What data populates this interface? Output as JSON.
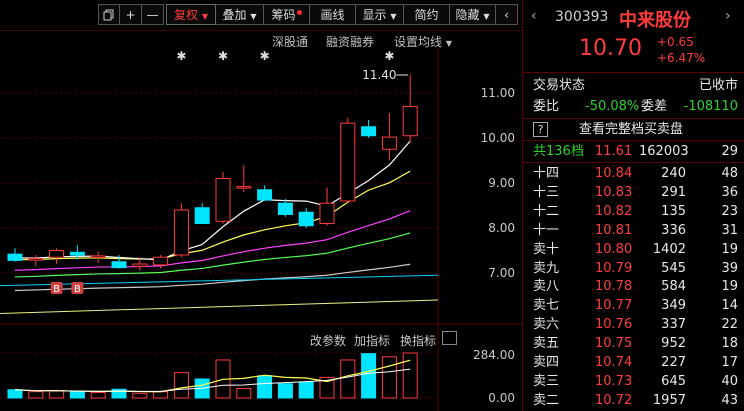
{
  "toolbar": {
    "copy_icon": "copy-icon",
    "plus": "+",
    "minus": "—",
    "fuquan": "复权",
    "diejia": "叠加",
    "chouma": "筹码",
    "huaxian": "画线",
    "xianshi": "显示",
    "jianyue": "简约",
    "yincang": "隐藏"
  },
  "subtoolbar": {
    "shengutong": "深股通",
    "rongzirongquan": "融资融券",
    "shezhi_junxian": "设置均线"
  },
  "chart": {
    "yticks": [
      "11.00",
      "10.00",
      "9.00",
      "8.00",
      "7.00"
    ],
    "max_label": "11.40",
    "b_marker": "B",
    "vol_tabs": {
      "gai": "改参数",
      "jia": "加指标",
      "huan": "换指标"
    },
    "vol_yticks": [
      "284.00",
      "0.00"
    ],
    "colors": {
      "up": "#ff3b3b",
      "down": "#00e5ff",
      "ma5": "#ffffff",
      "ma10": "#ffff55",
      "ma20": "#ff40ff",
      "ma30": "#55ff55",
      "ma60": "#cccccc"
    }
  },
  "chart_data": {
    "type": "candlestick",
    "candles": [
      {
        "o": 7.42,
        "h": 7.55,
        "l": 7.25,
        "c": 7.28
      },
      {
        "o": 7.3,
        "h": 7.4,
        "l": 7.15,
        "c": 7.32
      },
      {
        "o": 7.35,
        "h": 7.55,
        "l": 7.2,
        "c": 7.5
      },
      {
        "o": 7.46,
        "h": 7.62,
        "l": 7.3,
        "c": 7.4
      },
      {
        "o": 7.35,
        "h": 7.48,
        "l": 7.22,
        "c": 7.38
      },
      {
        "o": 7.25,
        "h": 7.4,
        "l": 7.1,
        "c": 7.12
      },
      {
        "o": 7.15,
        "h": 7.35,
        "l": 7.05,
        "c": 7.2
      },
      {
        "o": 7.18,
        "h": 7.4,
        "l": 7.1,
        "c": 7.35
      },
      {
        "o": 7.4,
        "h": 8.55,
        "l": 7.35,
        "c": 8.4
      },
      {
        "o": 8.45,
        "h": 8.55,
        "l": 8.1,
        "c": 8.1
      },
      {
        "o": 8.15,
        "h": 9.25,
        "l": 8.1,
        "c": 9.1
      },
      {
        "o": 8.9,
        "h": 9.4,
        "l": 8.8,
        "c": 8.92
      },
      {
        "o": 8.85,
        "h": 8.95,
        "l": 8.6,
        "c": 8.62
      },
      {
        "o": 8.55,
        "h": 8.65,
        "l": 8.25,
        "c": 8.3
      },
      {
        "o": 8.35,
        "h": 8.45,
        "l": 8.0,
        "c": 8.05
      },
      {
        "o": 8.1,
        "h": 8.9,
        "l": 8.05,
        "c": 8.55
      },
      {
        "o": 8.6,
        "h": 10.45,
        "l": 8.55,
        "c": 10.33
      },
      {
        "o": 10.25,
        "h": 10.4,
        "l": 10.0,
        "c": 10.05
      },
      {
        "o": 9.75,
        "h": 10.55,
        "l": 9.5,
        "c": 10.02
      },
      {
        "o": 10.05,
        "h": 11.4,
        "l": 9.9,
        "c": 10.7
      }
    ],
    "volumes": [
      52,
      40,
      45,
      38,
      35,
      55,
      30,
      40,
      160,
      120,
      240,
      60,
      140,
      90,
      100,
      130,
      240,
      280,
      260,
      284
    ]
  },
  "stock": {
    "code": "300393",
    "name": "中来股份",
    "price": "10.70",
    "change": "+0.65",
    "pct": "+6.47%"
  },
  "trade": {
    "status_label": "交易状态",
    "status_value": "已收市",
    "weibi_label": "委比",
    "weibi_value": "-50.08%",
    "weicha_label": "委差",
    "weicha_value": "-108110",
    "full_book": "查看完整档买卖盘",
    "total_label": "共136档",
    "total_price": "11.61",
    "total_vol": "162003",
    "total_cnt": "29"
  },
  "asks": [
    {
      "label": "十四",
      "price": "10.84",
      "vol": "240",
      "cnt": "48"
    },
    {
      "label": "十三",
      "price": "10.83",
      "vol": "291",
      "cnt": "36"
    },
    {
      "label": "十二",
      "price": "10.82",
      "vol": "135",
      "cnt": "23"
    },
    {
      "label": "十一",
      "price": "10.81",
      "vol": "336",
      "cnt": "31"
    },
    {
      "label": "卖十",
      "price": "10.80",
      "vol": "1402",
      "cnt": "19"
    },
    {
      "label": "卖九",
      "price": "10.79",
      "vol": "545",
      "cnt": "39"
    },
    {
      "label": "卖八",
      "price": "10.78",
      "vol": "584",
      "cnt": "19"
    },
    {
      "label": "卖七",
      "price": "10.77",
      "vol": "349",
      "cnt": "14"
    },
    {
      "label": "卖六",
      "price": "10.76",
      "vol": "337",
      "cnt": "22"
    },
    {
      "label": "卖五",
      "price": "10.75",
      "vol": "952",
      "cnt": "18"
    },
    {
      "label": "卖四",
      "price": "10.74",
      "vol": "227",
      "cnt": "17"
    },
    {
      "label": "卖三",
      "price": "10.73",
      "vol": "645",
      "cnt": "40"
    },
    {
      "label": "卖二",
      "price": "10.72",
      "vol": "1957",
      "cnt": "43"
    }
  ]
}
